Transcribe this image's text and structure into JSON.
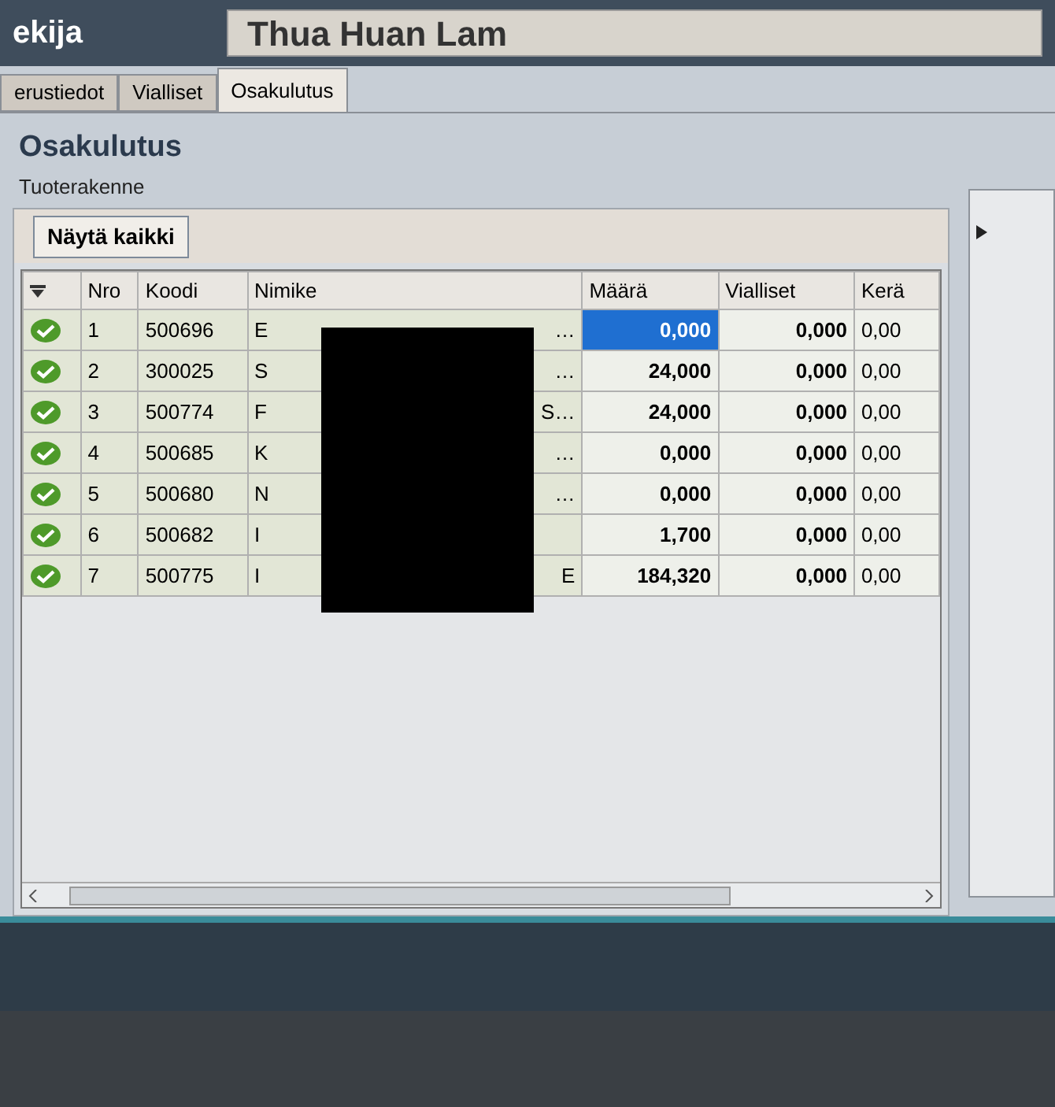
{
  "header": {
    "label": "ekija",
    "field_value": "Thua Huan Lam"
  },
  "tabs": [
    {
      "label": "erustiedot",
      "selected": false
    },
    {
      "label": "Vialliset",
      "selected": false
    },
    {
      "label": "Osakulutus",
      "selected": true
    }
  ],
  "section": {
    "title": "Osakulutus",
    "subtitle": "Tuoterakenne",
    "button": "Näytä kaikki"
  },
  "table": {
    "columns": [
      "Nro",
      "Koodi",
      "Nimike",
      "Määrä",
      "Vialliset",
      "Kerä"
    ],
    "rows": [
      {
        "checked": true,
        "nro": "1",
        "koodi": "500696",
        "nimike_start": "E",
        "nimike_end": "…",
        "maara": "0,000",
        "maara_selected": true,
        "vialliset": "0,000",
        "kera": "0,00"
      },
      {
        "checked": true,
        "nro": "2",
        "koodi": "300025",
        "nimike_start": "S",
        "nimike_end": "…",
        "maara": "24,000",
        "maara_selected": false,
        "vialliset": "0,000",
        "kera": "0,00"
      },
      {
        "checked": true,
        "nro": "3",
        "koodi": "500774",
        "nimike_start": "F",
        "nimike_end": "S…",
        "maara": "24,000",
        "maara_selected": false,
        "vialliset": "0,000",
        "kera": "0,00"
      },
      {
        "checked": true,
        "nro": "4",
        "koodi": "500685",
        "nimike_start": "K",
        "nimike_end": "…",
        "maara": "0,000",
        "maara_selected": false,
        "vialliset": "0,000",
        "kera": "0,00"
      },
      {
        "checked": true,
        "nro": "5",
        "koodi": "500680",
        "nimike_start": "N",
        "nimike_end": "…",
        "maara": "0,000",
        "maara_selected": false,
        "vialliset": "0,000",
        "kera": "0,00"
      },
      {
        "checked": true,
        "nro": "6",
        "koodi": "500682",
        "nimike_start": "I",
        "maara": "1,700",
        "maara_selected": false,
        "vialliset": "0,000",
        "kera": "0,00"
      },
      {
        "checked": true,
        "nro": "7",
        "koodi": "500775",
        "nimike_start": "I",
        "nimike_end": "E",
        "maara": "184,320",
        "maara_selected": false,
        "vialliset": "0,000",
        "kera": "0,00"
      }
    ]
  }
}
